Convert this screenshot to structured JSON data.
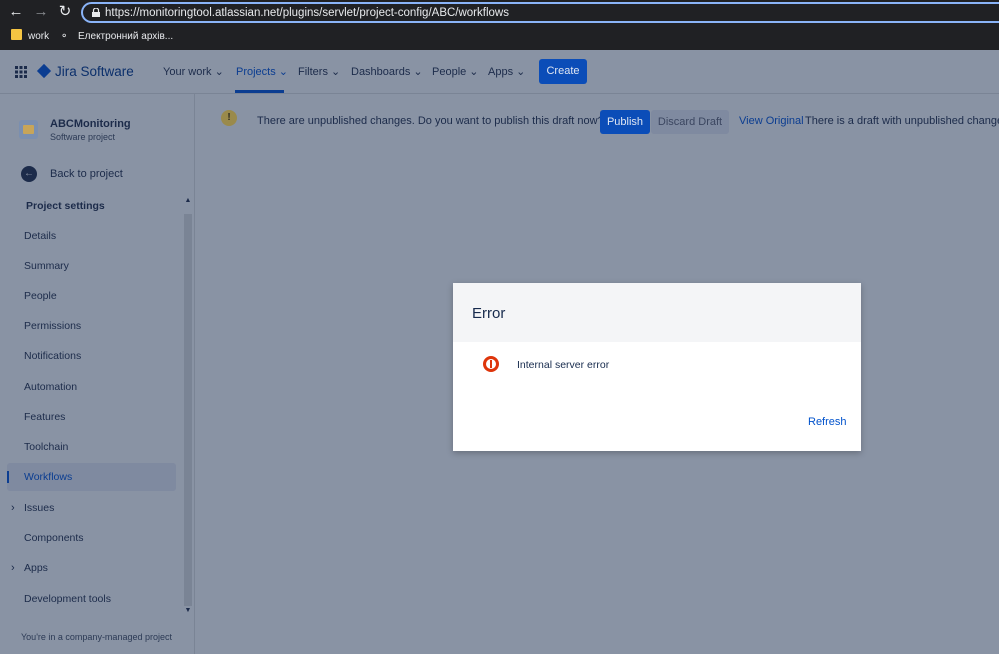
{
  "browser": {
    "url": "https://monitoringtool.atlassian.net/plugins/servlet/project-config/ABC/workflows",
    "bookmarks": [
      {
        "label": "work"
      },
      {
        "label": "Електронний архів..."
      }
    ],
    "nav_icons": [
      "back-arrow-icon",
      "forward-arrow-icon",
      "reload-icon",
      "lock-icon"
    ]
  },
  "jira_nav": {
    "product": "Jira Software",
    "items": [
      {
        "label": "Your work ⌄"
      },
      {
        "label": "Projects ⌄"
      },
      {
        "label": "Filters ⌄"
      },
      {
        "label": "Dashboards ⌄"
      },
      {
        "label": "People ⌄"
      },
      {
        "label": "Apps ⌄"
      }
    ],
    "create": "Create"
  },
  "sidebar": {
    "project_name": "ABCMonitoring",
    "project_type": "Software project",
    "back": "Back to project",
    "section": "Project settings",
    "items": [
      {
        "label": "Details"
      },
      {
        "label": "Summary"
      },
      {
        "label": "People"
      },
      {
        "label": "Permissions"
      },
      {
        "label": "Notifications"
      },
      {
        "label": "Automation"
      },
      {
        "label": "Features"
      },
      {
        "label": "Toolchain"
      },
      {
        "label": "Workflows"
      },
      {
        "label": "Issues"
      },
      {
        "label": "Components"
      },
      {
        "label": "Apps"
      },
      {
        "label": "Development tools"
      }
    ],
    "footer": "You're in a company-managed project"
  },
  "banner": {
    "text": "There are unpublished changes. Do you want to publish this draft now?",
    "publish": "Publish",
    "discard": "Discard Draft",
    "view_original": "View Original",
    "note": "There is a draft with unpublished changes"
  },
  "dialog": {
    "title": "Error",
    "message": "Internal server error",
    "refresh": "Refresh"
  },
  "colors": {
    "overlay": "#8993a4",
    "brand_blue": "#0052cc",
    "error_red": "#de350b"
  }
}
